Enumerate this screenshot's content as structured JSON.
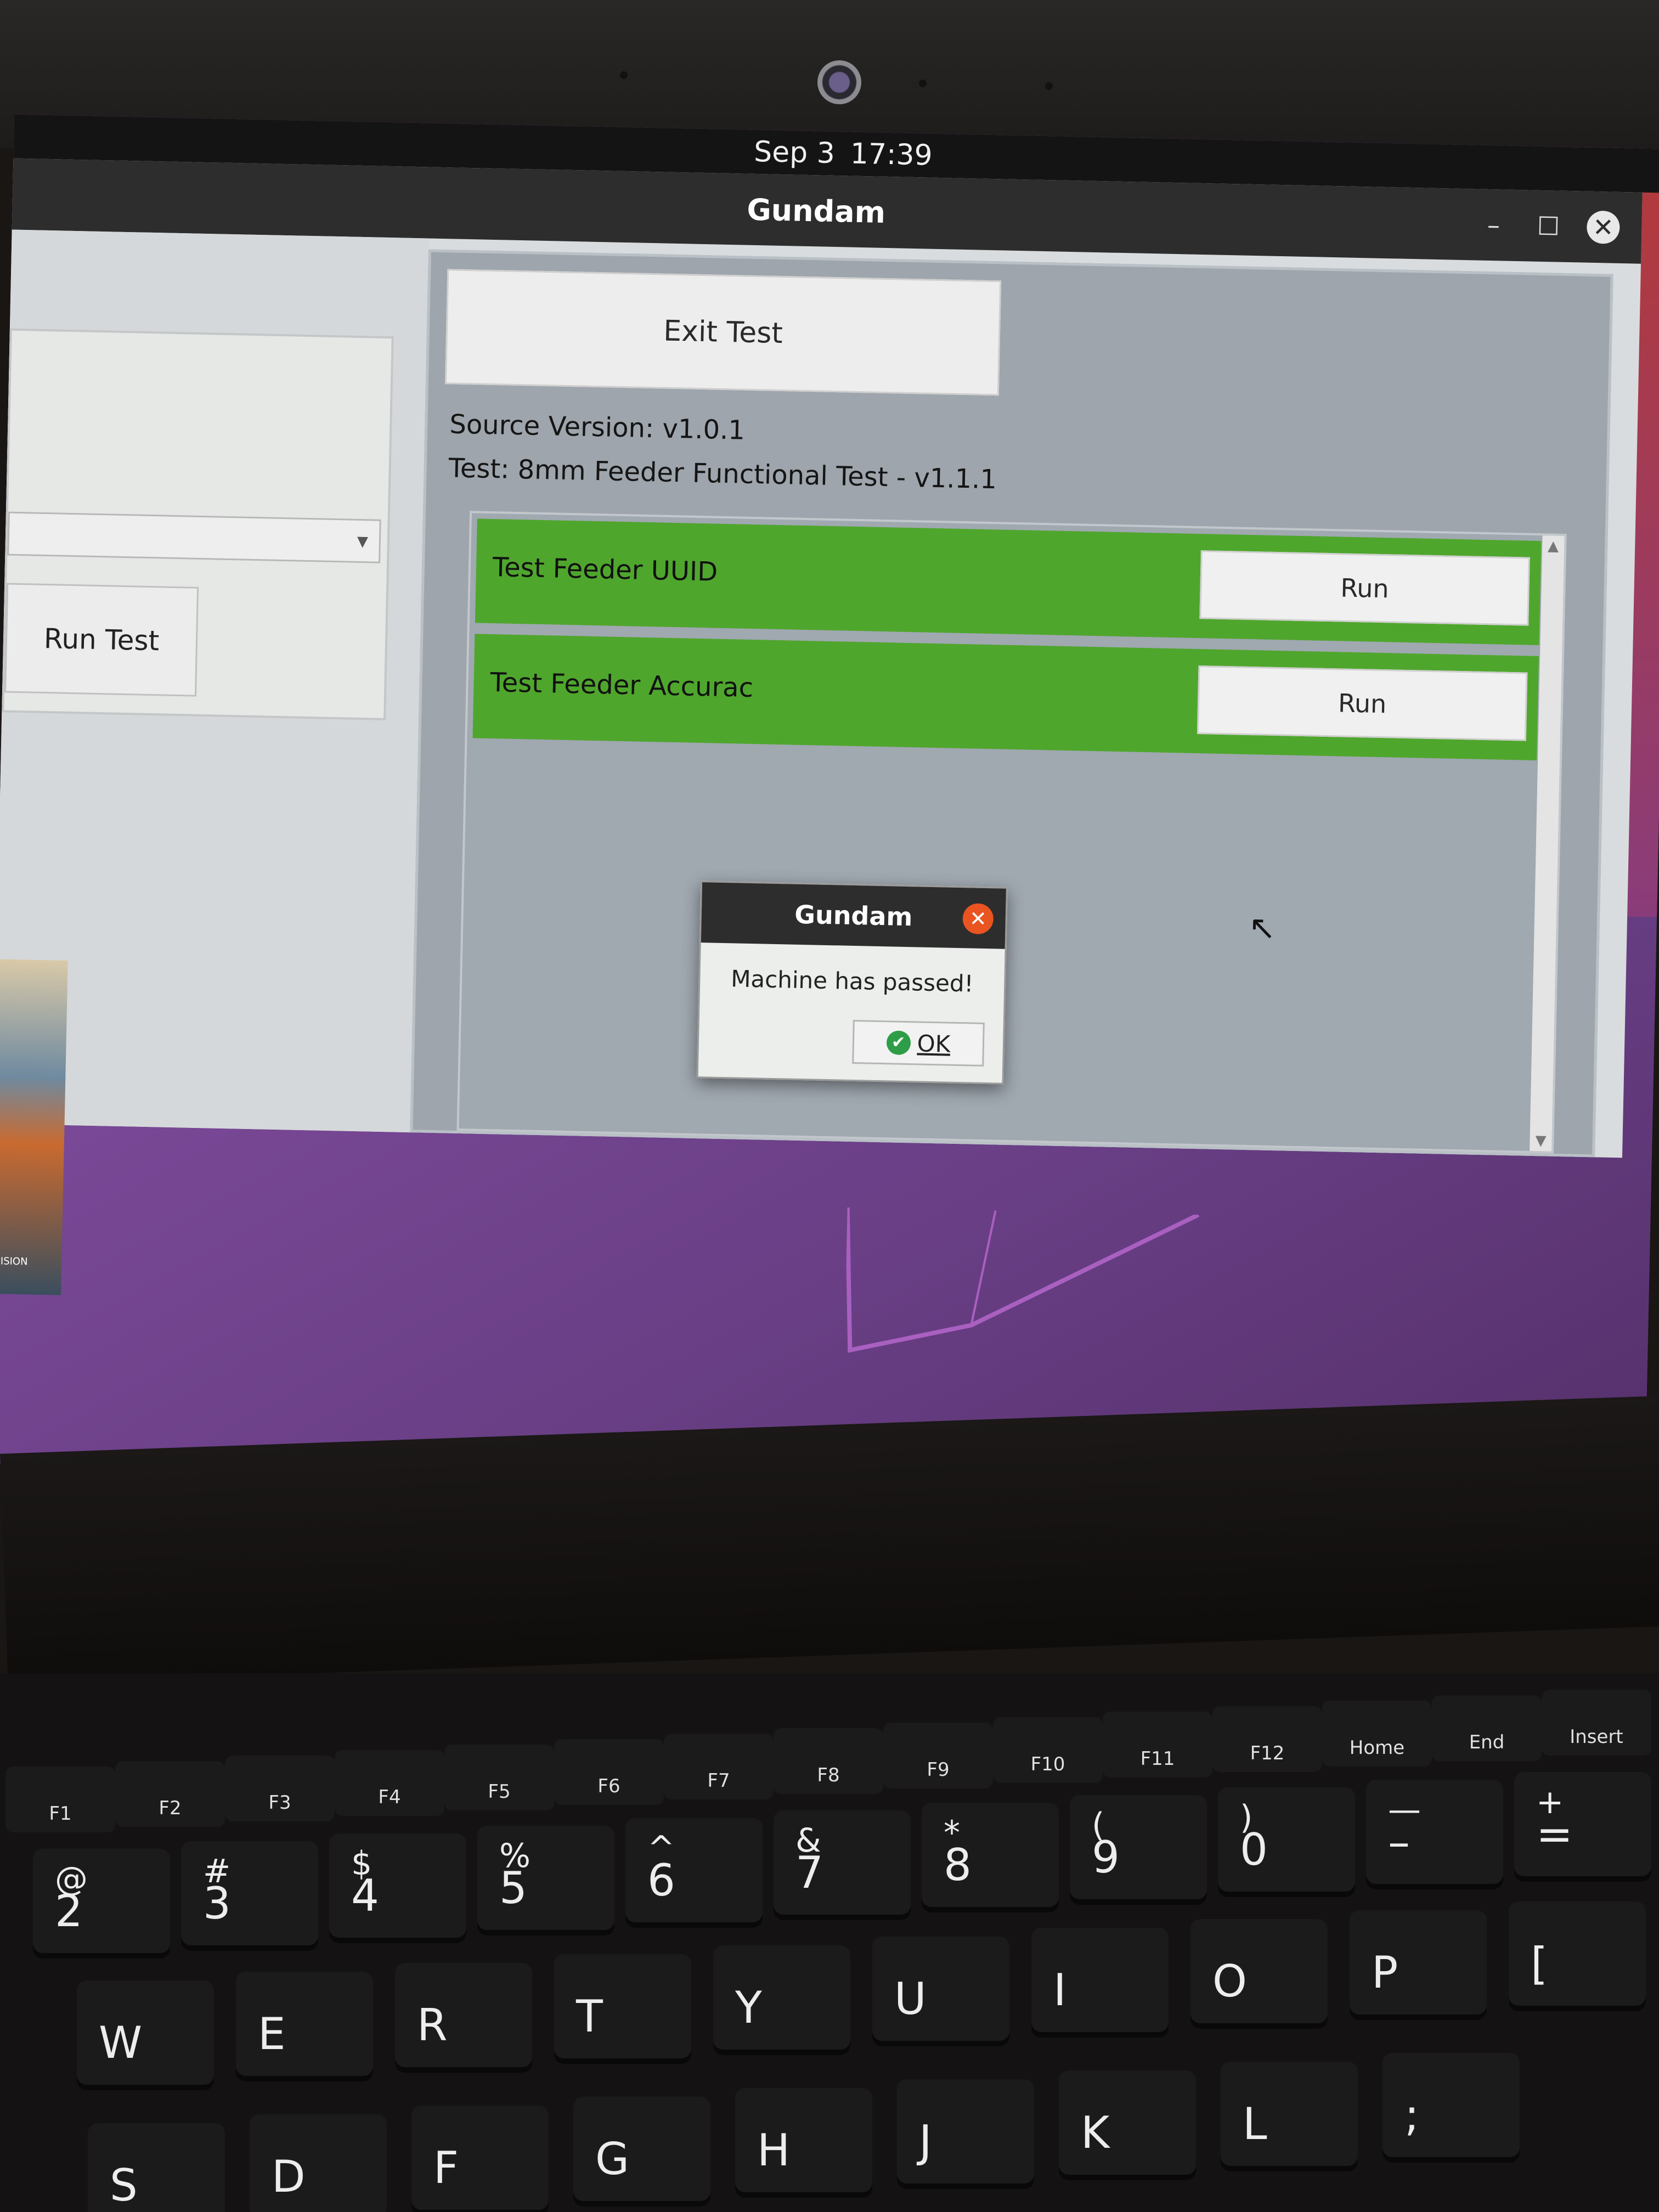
{
  "topbar": {
    "date": "Sep 3",
    "time": "17:39"
  },
  "window": {
    "title": "Gundam",
    "minimize_glyph": "–",
    "maximize_glyph": "☐",
    "close_glyph": "✕"
  },
  "left_panel": {
    "run_test_label": "Run Test",
    "dropdown_glyph": "▾",
    "poster_text": "CISION"
  },
  "right_panel": {
    "exit_label": "Exit Test",
    "source_version": "Source Version: v1.0.1",
    "test_name": "Test: 8mm Feeder Functional Test - v1.1.1",
    "tests": [
      {
        "label": "Test Feeder UUID",
        "run_label": "Run",
        "status_color": "#4fa62d"
      },
      {
        "label": "Test Feeder Accurac",
        "run_label": "Run",
        "status_color": "#4fa62d"
      }
    ],
    "scroll_up": "▲",
    "scroll_down": "▼"
  },
  "dialog": {
    "title": "Gundam",
    "close_glyph": "✕",
    "message": "Machine has passed!",
    "ok_label": "OK",
    "ok_icon": "✔"
  },
  "keyboard": {
    "fkeys": [
      "F1",
      "F2",
      "F3",
      "F4",
      "F5",
      "F6",
      "F7",
      "F8",
      "F9",
      "F10",
      "F11",
      "F12",
      "Home",
      "End",
      "Insert"
    ],
    "number_row": [
      {
        "main": "2",
        "shift": "@"
      },
      {
        "main": "3",
        "shift": "#"
      },
      {
        "main": "4",
        "shift": "$"
      },
      {
        "main": "5",
        "shift": "%"
      },
      {
        "main": "6",
        "shift": "^"
      },
      {
        "main": "7",
        "shift": "&"
      },
      {
        "main": "8",
        "shift": "*"
      },
      {
        "main": "9",
        "shift": "("
      },
      {
        "main": "0",
        "shift": ")"
      },
      {
        "main": "–",
        "shift": "—"
      },
      {
        "main": "=",
        "shift": "+"
      }
    ],
    "top_row": [
      "W",
      "E",
      "R",
      "T",
      "Y",
      "U",
      "I",
      "O",
      "P",
      "["
    ],
    "home_row": [
      "S",
      "D",
      "F",
      "G",
      "H",
      "J",
      "K",
      "L",
      ";"
    ]
  },
  "colors": {
    "accent_orange": "#e95420",
    "pass_green": "#4fa62d",
    "titlebar": "#2d2d2d"
  }
}
